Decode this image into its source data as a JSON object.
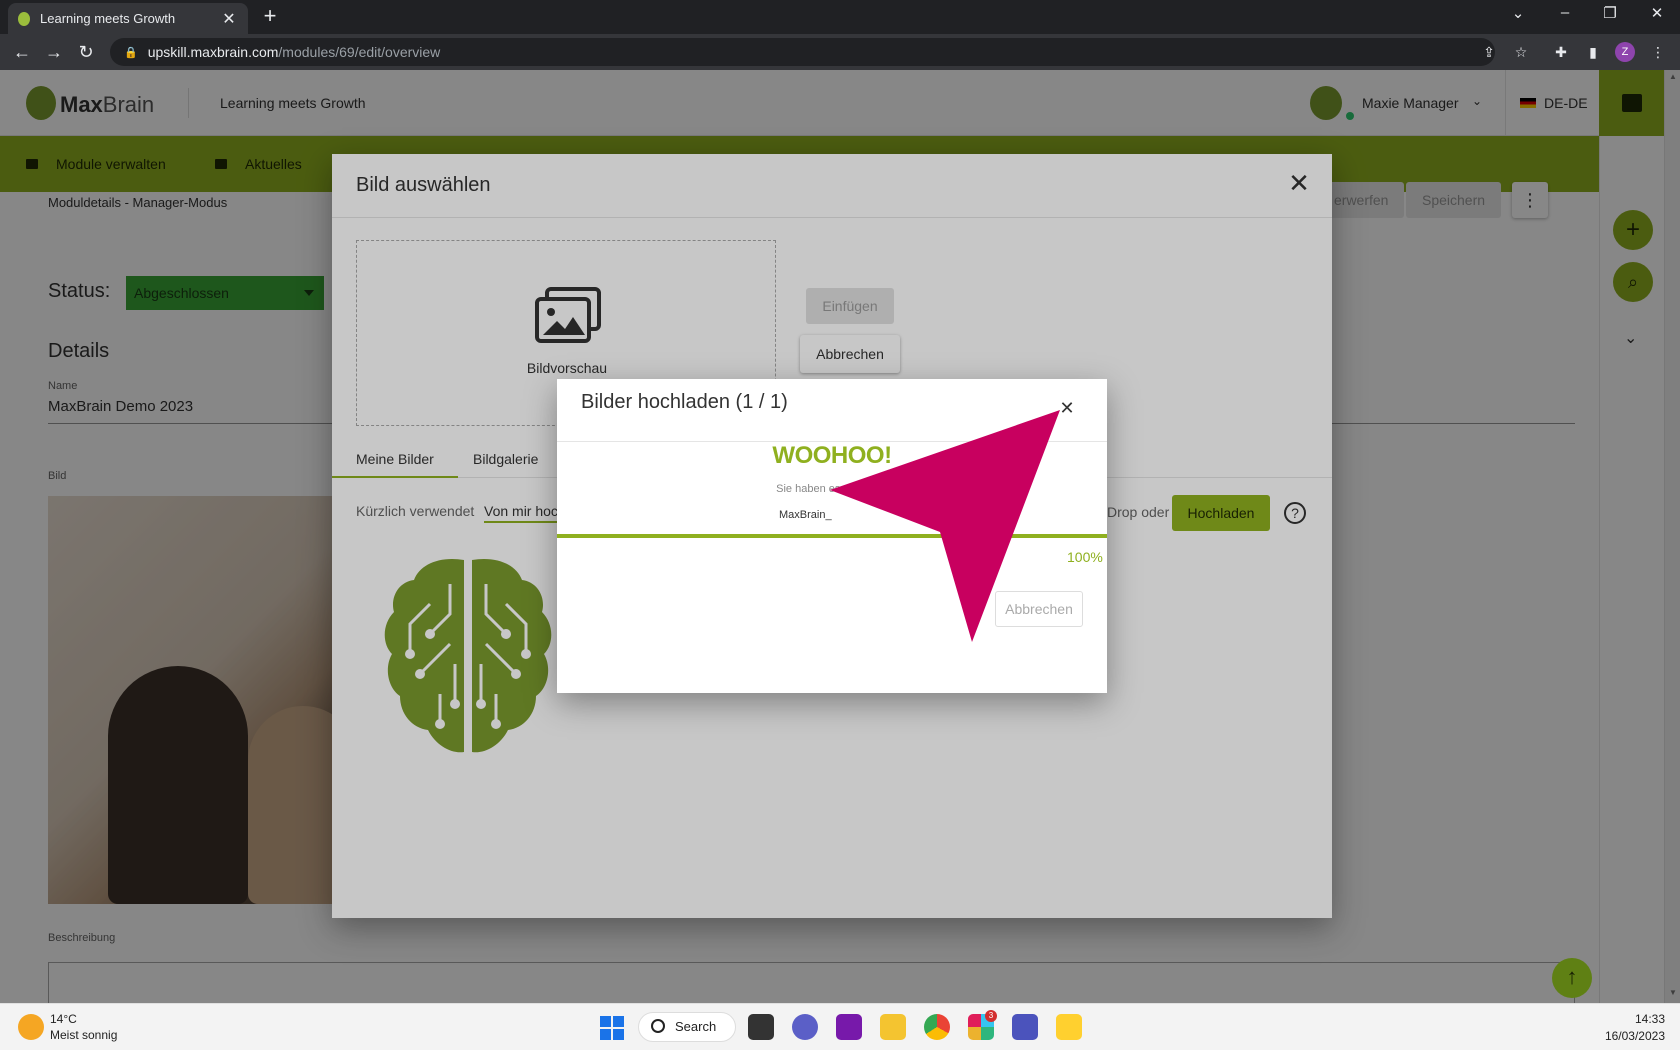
{
  "browser": {
    "tab_title": "Learning meets Growth",
    "url_host": "upskill.maxbrain.com",
    "url_path": "/modules/69/edit/overview",
    "profile_initial": "Z"
  },
  "app": {
    "brand_bold": "Max",
    "brand_light": "Brain",
    "slogan": "Learning meets Growth",
    "user_name": "Maxie Manager",
    "language": "DE-DE",
    "menu": [
      "Module verwalten",
      "Aktuelles"
    ],
    "breadcrumb": "Moduldetails - Manager-Modus",
    "toolbar": {
      "discard_label": "erwerfen",
      "save_label": "Speichern"
    },
    "status_label": "Status:",
    "status_value": "Abgeschlossen",
    "details_title": "Details",
    "name_label": "Name",
    "name_value": "MaxBrain Demo 2023",
    "image_label": "Bild",
    "description_label": "Beschreibung"
  },
  "select_modal": {
    "title": "Bild auswählen",
    "preview_text": "Bildvorschau",
    "insert_label": "Einfügen",
    "cancel_label": "Abbrechen",
    "tabs": [
      "Meine Bilder",
      "Bildgalerie"
    ],
    "filter_recent": "Kürzlich verwendet",
    "filter_mine": "Von mir hochgeladen",
    "drop_text": "Drop oder",
    "upload_label": "Hochladen"
  },
  "upload_modal": {
    "title": "Bilder hochladen (1 / 1)",
    "headline": "WOOHOO!",
    "subtext": "Sie haben es geschafft",
    "file_name": "MaxBrain_",
    "progress_percent": 100,
    "progress_label": "100%",
    "cancel_label": "Abbrechen"
  },
  "taskbar": {
    "temperature": "14°C",
    "weather": "Meist sonnig",
    "search_label": "Search",
    "slack_badge": "3",
    "time": "14:33",
    "date": "16/03/2023"
  },
  "colors": {
    "brand_green": "#8fb01f",
    "status_green": "#3aa635",
    "annotation_magenta": "#c8005f"
  }
}
